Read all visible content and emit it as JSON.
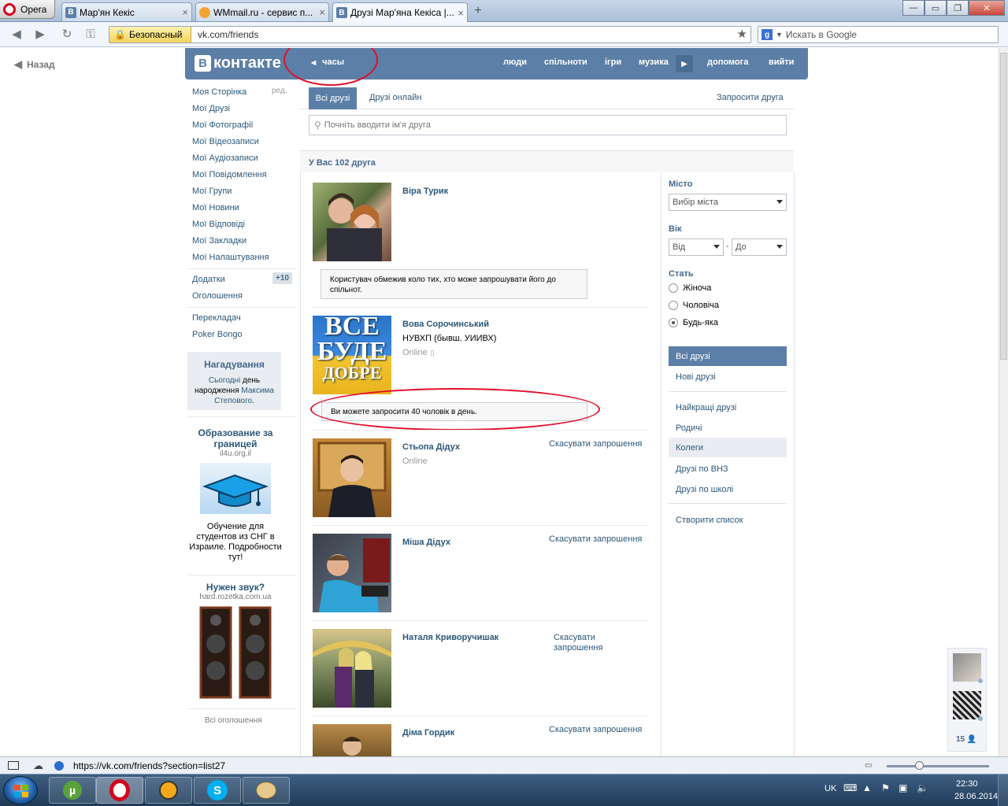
{
  "browser": {
    "opera_label": "Opera",
    "tabs": [
      {
        "title": "Мар'ян Кекіс",
        "favicon": "vk-icon",
        "active": false
      },
      {
        "title": "WMmail.ru - сервис п...",
        "favicon": "wmmail-icon",
        "active": false
      },
      {
        "title": "Друзі Мар'яна Кекіса |...",
        "favicon": "vk-icon",
        "active": true
      }
    ],
    "secure_label": "Безопасный",
    "url": "vk.com/friends",
    "search_placeholder": "Искать в Google",
    "status_url": "https://vk.com/friends?section=list27"
  },
  "page": {
    "back_label": "Назад",
    "logo_text": "контакте",
    "hours_label": "часы",
    "nav": [
      "люди",
      "спільноти",
      "ігри",
      "музика",
      "допомога",
      "вийти"
    ],
    "left_menu": [
      "Моя Сторінка",
      "Мої Друзі",
      "Мої Фотографії",
      "Мої Відеозаписи",
      "Мої Аудіозаписи",
      "Мої Повідомлення",
      "Мої Групи",
      "Мої Новини",
      "Мої Відповіді",
      "Мої Закладки",
      "Мої Налаштування"
    ],
    "edit_label": "ред.",
    "apps_label": "Додатки",
    "apps_badge": "+10",
    "ads_link": "Оголошення",
    "translator_label": "Перекладач",
    "poker_label": "Poker Bongo",
    "reminder": {
      "title": "Нагадування",
      "today": "Сьогодні",
      "text": "день народження",
      "name": "Максима Степового",
      "dot": "."
    },
    "ad1": {
      "title": "Образование за границей",
      "url": "il4u.org.il",
      "text": "Обучение для студентов из СНГ в Израиле. Подробности тут!"
    },
    "ad2": {
      "title": "Нужен звук?",
      "url": "hard.rozetka.com.ua"
    },
    "all_ads": "Всі оголошення",
    "tabs": {
      "all": "Всі друзі",
      "online": "Друзі онлайн",
      "invite": "Запросити друга"
    },
    "search_placeholder": "Почніть вводити ім'я друга",
    "friends_count": "У Вас 102 друга",
    "friends": [
      {
        "name": "Віра Турик",
        "subtitle": "",
        "status": "",
        "action": ""
      },
      {
        "name": "Вова Сорочинський",
        "subtitle": "НУВХП (бывш. УИИВХ)",
        "status": "Online",
        "action": ""
      },
      {
        "name": "Стьопа Дідух",
        "subtitle": "",
        "status": "Online",
        "action": "Скасувати запрошення"
      },
      {
        "name": "Міша Дідух",
        "subtitle": "",
        "status": "",
        "action": "Скасувати запрошення"
      },
      {
        "name": "Наталя Криворучишак",
        "subtitle": "",
        "status": "",
        "action": "Скасувати запрошення"
      },
      {
        "name": "Діма Гордик",
        "subtitle": "",
        "status": "",
        "action": "Скасувати запрошення"
      }
    ],
    "notice1": "Користувач обмежив коло тих, хто може запрошувати його до спільнот.",
    "notice2": "Ви можете запросити 40 чоловік в день.",
    "vova_photo_text": [
      "ВСЕ",
      "БУДЕ",
      "ДОБРЕ"
    ],
    "filters": {
      "city_label": "Місто",
      "city_value": "Вибір міста",
      "age_label": "Вік",
      "age_from": "Від",
      "age_dash": "-",
      "age_to": "До",
      "sex_label": "Стать",
      "sex_options": [
        {
          "label": "Жіноча",
          "selected": false
        },
        {
          "label": "Чоловіча",
          "selected": false
        },
        {
          "label": "Будь-яка",
          "selected": true
        }
      ]
    },
    "lists": {
      "group1": [
        "Всі друзі",
        "Нові друзі"
      ],
      "group2": [
        "Найкращі друзі",
        "Родичі",
        "Колеги",
        "Друзі по ВНЗ",
        "Друзі по школі"
      ],
      "create": "Створити список"
    },
    "mini_count": "15"
  },
  "taskbar": {
    "lang": "UK",
    "time": "22:30",
    "date": "28.06.2014"
  },
  "colors": {
    "vk_blue": "#5b7fa6",
    "link": "#2b587a",
    "annotation_red": "#e0102a"
  }
}
